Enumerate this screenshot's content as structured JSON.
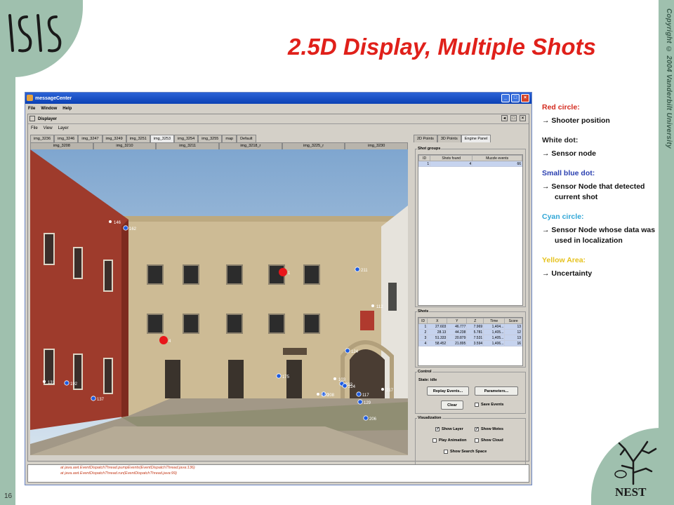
{
  "slide": {
    "title": "2.5D Display, Multiple Shots",
    "copyright": "Copyright © 2004 Vanderbilt University",
    "page_number": "16",
    "logo_text": "ISIS",
    "nest_text": "NEST"
  },
  "outer_window": {
    "title": "messageCenter",
    "menu": [
      "File",
      "Window",
      "Help"
    ]
  },
  "inner_window": {
    "title": "Displayer",
    "menu": [
      "File",
      "View",
      "Layer"
    ]
  },
  "image_tabs_row1": [
    "img_3236",
    "img_3246",
    "img_3247",
    "img_3249",
    "img_3251",
    "img_3253",
    "img_3254",
    "img_3255",
    "map",
    "Default"
  ],
  "image_tabs_row1_active": "img_3253",
  "image_tabs_row2": [
    "img_3208",
    "img_3210",
    "img_3211",
    "img_3218_r",
    "img_3225_r",
    "img_3230"
  ],
  "markers": [
    {
      "label": "146",
      "color": "white"
    },
    {
      "label": "162",
      "color": "blue"
    },
    {
      "label": "211",
      "color": "blue"
    },
    {
      "label": "112",
      "color": "white"
    },
    {
      "label": "124",
      "color": "blue"
    },
    {
      "label": "175",
      "color": "blue"
    },
    {
      "label": "131",
      "color": "white"
    },
    {
      "label": "192",
      "color": "blue"
    },
    {
      "label": "137",
      "color": "blue"
    },
    {
      "label": "103",
      "color": "white"
    },
    {
      "label": "222",
      "color": "blue"
    },
    {
      "label": "224",
      "color": "blue"
    },
    {
      "label": "208",
      "color": "blue"
    },
    {
      "label": "100",
      "color": "white"
    },
    {
      "label": "117",
      "color": "blue"
    },
    {
      "label": "217",
      "color": "white"
    },
    {
      "label": "129",
      "color": "blue"
    },
    {
      "label": "206",
      "color": "blue"
    },
    {
      "label": "1",
      "color": "red"
    },
    {
      "label": "4",
      "color": "red"
    }
  ],
  "panel": {
    "tabs": [
      "2D Points",
      "3D Points",
      "Engine Panel"
    ],
    "active_tab": "Engine Panel",
    "shot_groups": {
      "label": "Shot groups",
      "columns": [
        "ID",
        "Shots found",
        "Muzzle events"
      ],
      "rows": [
        [
          "1",
          "4",
          "66"
        ]
      ]
    },
    "shots": {
      "label": "Shots",
      "columns": [
        "ID",
        "X",
        "Y",
        "Z",
        "Time",
        "Score"
      ],
      "rows": [
        [
          "1",
          "27.603",
          "46.777",
          "7.969",
          "1,404...",
          "13"
        ],
        [
          "2",
          "28.13",
          "44.238",
          "5.781",
          "1,405...",
          "12"
        ],
        [
          "3",
          "51.333",
          "20.879",
          "7.531",
          "1,405...",
          "13"
        ],
        [
          "4",
          "58.452",
          "21.895",
          "3.594",
          "1,406...",
          "16"
        ]
      ]
    },
    "control": {
      "label": "Control",
      "state": "State: idle",
      "replay": "Replay Events...",
      "parameters": "Parameters...",
      "clear": "Clear",
      "save_events": "Save Events"
    },
    "visualization": {
      "label": "Visualization",
      "show_layer": "Show Layer",
      "show_motes": "Show Motes",
      "play_animation": "Play Animation",
      "show_cloud": "Show Cloud",
      "show_search_space": "Show Search Space"
    }
  },
  "console": {
    "lines": [
      "at java.awt.EventDispatchThread.pumpEvents(EventDispatchThread.java:136)",
      "at java.awt.EventDispatchThread.run(EventDispatchThread.java:99)"
    ]
  },
  "legend": [
    {
      "head": "Red circle:",
      "color": "#d42b1f",
      "items": [
        "Shooter position"
      ]
    },
    {
      "head": "White dot:",
      "color": "#222222",
      "items": [
        "Sensor node"
      ]
    },
    {
      "head": "Small blue dot:",
      "color": "#2a3fb0",
      "items": [
        "Sensor Node that detected current shot"
      ]
    },
    {
      "head": "Cyan circle:",
      "color": "#2fa6d6",
      "items": [
        "Sensor Node whose data was used in localization"
      ]
    },
    {
      "head": "Yellow Area:",
      "color": "#e6c21e",
      "items": [
        "Uncertainty"
      ]
    }
  ],
  "arrow_glyph": "→"
}
